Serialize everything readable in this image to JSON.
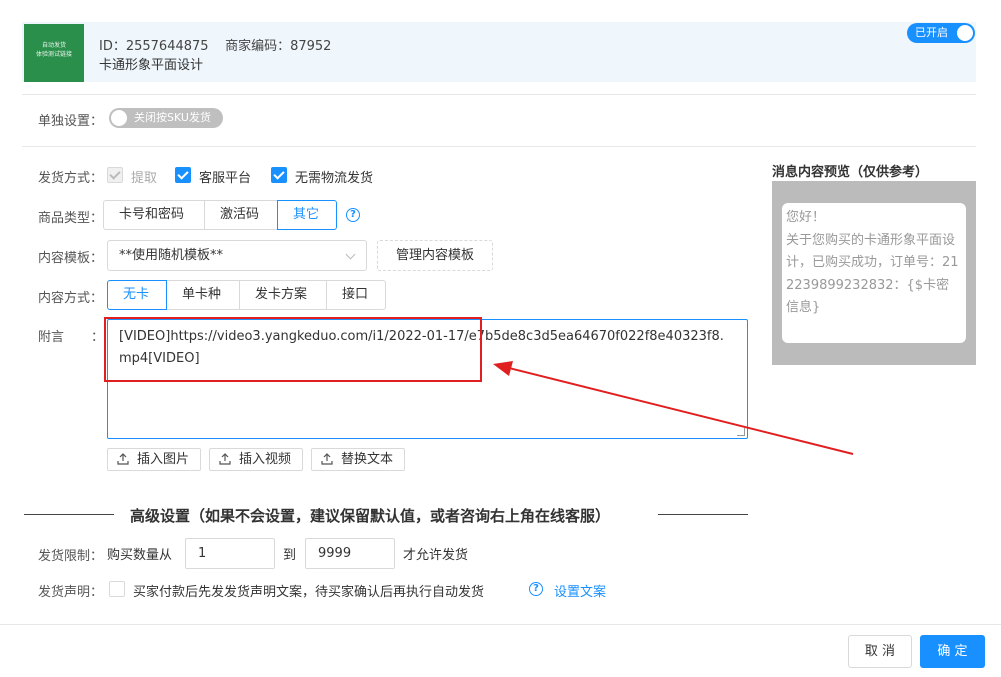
{
  "header": {
    "thumbnail_text": "自动发货\n体验测试链接",
    "id_line": "ID：2557644875    商家编码：87952",
    "product_name": "卡通形象平面设计",
    "status_toggle": "已开启"
  },
  "individual_setting": {
    "label": "单独设置：",
    "toggle_text": "关闭按SKU发货"
  },
  "delivery_method": {
    "label": "发货方式：",
    "options": [
      {
        "label": "提取",
        "checked": true,
        "disabled": true
      },
      {
        "label": "客服平台",
        "checked": true,
        "disabled": false
      },
      {
        "label": "无需物流发货",
        "checked": true,
        "disabled": false
      }
    ]
  },
  "product_type": {
    "label": "商品类型：",
    "options": [
      "卡号和密码",
      "激活码",
      "其它"
    ],
    "selected": "其它"
  },
  "content_template": {
    "label": "内容模板：",
    "selected": "**使用随机模板**",
    "manage_button": "管理内容模板"
  },
  "content_method": {
    "label": "内容方式：",
    "options": [
      "无卡",
      "单卡种",
      "发卡方案",
      "接口"
    ],
    "selected": "无卡"
  },
  "note": {
    "label": "附言",
    "colon": "：",
    "value": "[VIDEO]https://video3.yangkeduo.com/i1/2022-01-17/e7b5de8c3d5ea64670f022f8e40323f8.mp4[VIDEO]",
    "buttons": [
      "插入图片",
      "插入视频",
      "替换文本"
    ]
  },
  "advanced": {
    "title": "高级设置（如果不会设置，建议保留默认值，或者咨询右上角在线客服）",
    "limit_label": "发货限制：",
    "limit_prefix": "购买数量从",
    "min_qty": "1",
    "to": "到",
    "max_qty": "9999",
    "limit_suffix": "才允许发货",
    "statement_label": "发货声明：",
    "statement_text": "买家付款后先发发货声明文案，待买家确认后再执行自动发货",
    "statement_link": "设置文案"
  },
  "preview": {
    "title": "消息内容预览（仅供参考）",
    "message": "您好！\n关于您购买的卡通形象平面设计，已购买成功，订单号：212239899232832：{$卡密信息}"
  },
  "footer": {
    "cancel": "取 消",
    "confirm": "确 定"
  },
  "colors": {
    "accent": "#1890ff",
    "annotation": "#e02020",
    "thumbnail": "#2a8f4b"
  }
}
